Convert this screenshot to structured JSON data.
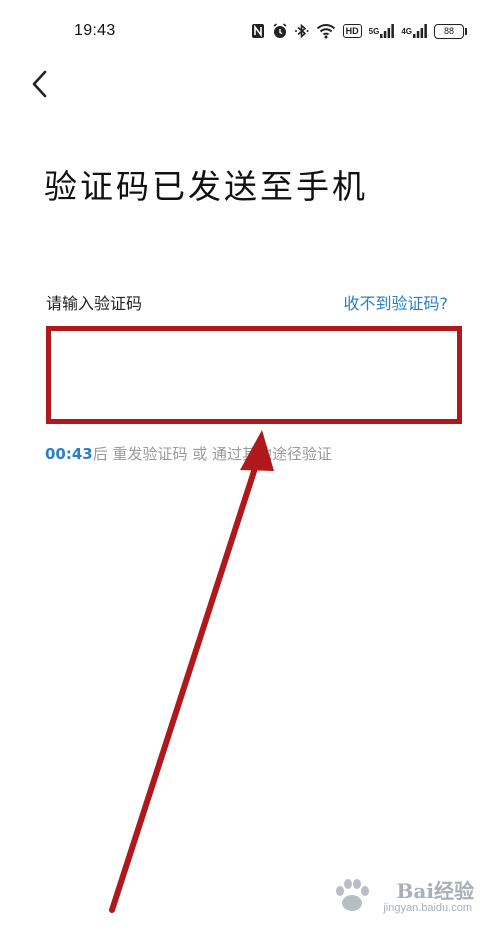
{
  "status_bar": {
    "time": "19:43",
    "network_1": "5G",
    "network_2": "4G",
    "hd_label": "HD",
    "battery": "88"
  },
  "header": {
    "title": "验证码已发送至手机"
  },
  "form": {
    "label": "请输入验证码",
    "help_link": "收不到验证码?",
    "code_value": "",
    "input_border_color": "#b0191c"
  },
  "resend": {
    "countdown": "00:43",
    "text": "后 重发验证码 或 通过其他途径验证"
  },
  "annotation": {
    "arrow_color": "#b0191c"
  },
  "watermark": {
    "brand": "Bai经验",
    "url": "jingyan.baidu.com"
  },
  "colors": {
    "accent": "#2a7fc9",
    "muted_text": "#9a9a9a"
  }
}
